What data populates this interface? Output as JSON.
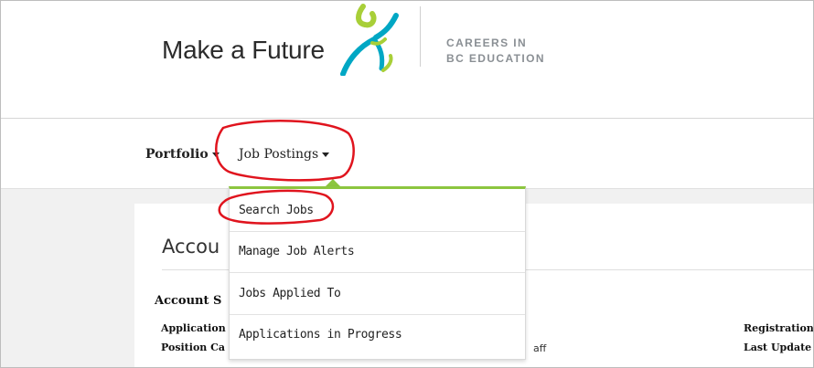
{
  "brand": {
    "name": "Make a Future",
    "tagline_line1": "CAREERS IN",
    "tagline_line2": "BC EDUCATION"
  },
  "nav": {
    "portfolio_label": "Portfolio",
    "jobs_label": "Job Postings"
  },
  "dropdown": {
    "items": [
      "Search Jobs",
      "Manage Job Alerts",
      "Jobs Applied To",
      "Applications in Progress"
    ]
  },
  "account": {
    "title": "Accou",
    "section_title": "Account S",
    "row1_label": "Application",
    "row2_label": "Position Ca",
    "row2_value_fragment": "aff",
    "right_label_1": "Registration",
    "right_label_2": "Last Update"
  },
  "colors": {
    "accent_green": "#8cc63f",
    "annotation_red": "#e0141e",
    "logo_teal": "#00a7c4",
    "logo_green": "#a8cf38"
  }
}
